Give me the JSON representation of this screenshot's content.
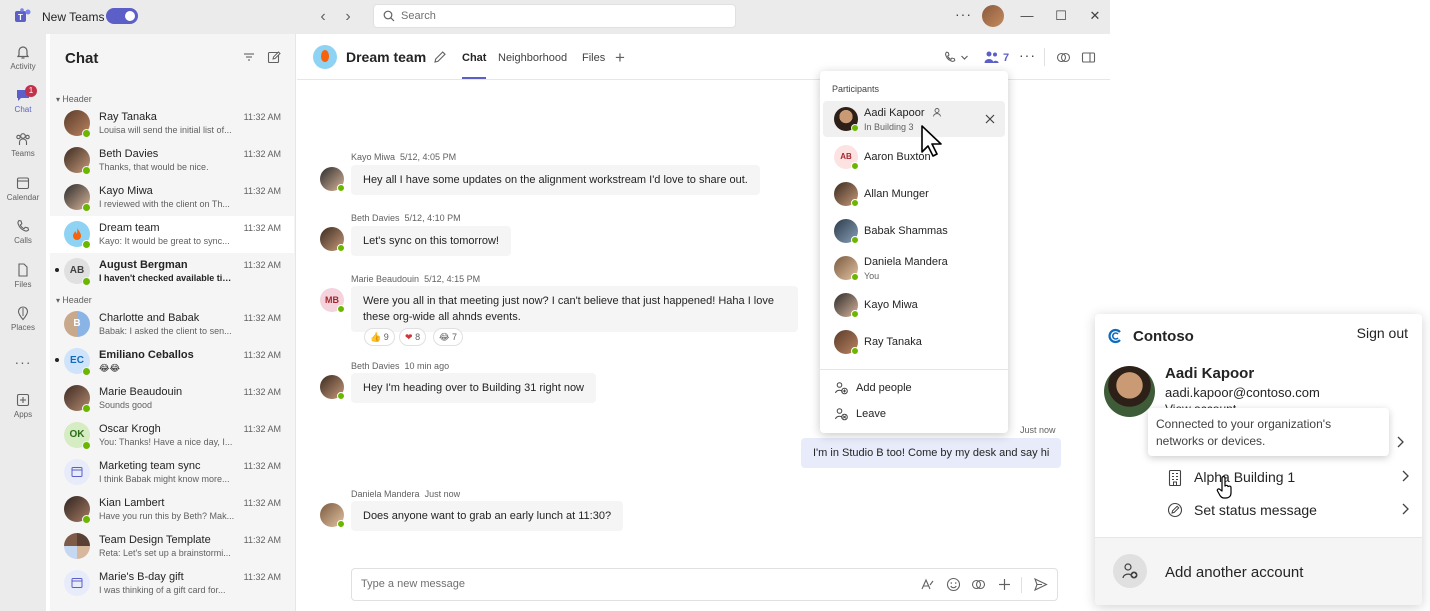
{
  "titlebar": {
    "app_label": "New Teams",
    "search_placeholder": "Search"
  },
  "rail": {
    "items": [
      {
        "label": "Activity",
        "icon": "bell-icon"
      },
      {
        "label": "Chat",
        "icon": "chat-icon",
        "badge": "1"
      },
      {
        "label": "Teams",
        "icon": "teams-icon"
      },
      {
        "label": "Calendar",
        "icon": "calendar-icon"
      },
      {
        "label": "Calls",
        "icon": "phone-icon"
      },
      {
        "label": "Files",
        "icon": "file-icon"
      },
      {
        "label": "Places",
        "icon": "location-icon"
      },
      {
        "label": "Apps",
        "icon": "apps-icon"
      }
    ]
  },
  "chatlist": {
    "title": "Chat",
    "section1": "Header",
    "section2": "Header",
    "items": [
      {
        "name": "Ray Tanaka",
        "preview": "Louisa will send the initial list of...",
        "time": "11:32 AM"
      },
      {
        "name": "Beth Davies",
        "preview": "Thanks, that would be nice.",
        "time": "11:32 AM"
      },
      {
        "name": "Kayo Miwa",
        "preview": "I reviewed with the client on Th...",
        "time": "11:32 AM"
      },
      {
        "name": "Dream team",
        "preview": "Kayo: It would be great to sync...",
        "time": "11:32 AM"
      },
      {
        "name": "August Bergman",
        "preview": "I haven't checked available tim...",
        "time": "11:32 AM",
        "initials": "AB"
      },
      {
        "name": "Charlotte and Babak",
        "preview": "Babak: I asked the client to sen...",
        "time": "11:32 AM"
      },
      {
        "name": "Emiliano Ceballos",
        "preview": "😂😂",
        "time": "11:32 AM",
        "initials": "EC"
      },
      {
        "name": "Marie Beaudouin",
        "preview": "Sounds good",
        "time": "11:32 AM"
      },
      {
        "name": "Oscar Krogh",
        "preview": "You: Thanks! Have a nice day, I...",
        "time": "11:32 AM",
        "initials": "OK"
      },
      {
        "name": "Marketing team sync",
        "preview": "I think Babak might know more...",
        "time": "11:32 AM"
      },
      {
        "name": "Kian Lambert",
        "preview": "Have you run this by Beth? Mak...",
        "time": "11:32 AM"
      },
      {
        "name": "Team Design Template",
        "preview": "Reta: Let's set up a brainstormi...",
        "time": "11:32 AM"
      },
      {
        "name": "Marie's B-day gift",
        "preview": "I was thinking of a gift card for...",
        "time": "11:32 AM"
      }
    ]
  },
  "conversation": {
    "title": "Dream team",
    "tabs": [
      "Chat",
      "Neighborhood",
      "Files"
    ],
    "participant_count": "7",
    "messages": [
      {
        "sender": "Kayo Miwa",
        "time": "5/12, 4:05 PM",
        "text": "Hey all I have some updates on the alignment workstream I'd love to share out."
      },
      {
        "sender": "Beth Davies",
        "time": "5/12, 4:10 PM",
        "text": "Let's sync on this tomorrow!"
      },
      {
        "sender": "Marie Beaudouin",
        "time": "5/12, 4:15 PM",
        "text": "Were you all in that meeting just now? I can't believe that just happened! Haha I love these org-wide all ahnds events.",
        "initials": "MB"
      },
      {
        "sender": "Beth Davies",
        "time": "10 min ago",
        "text": "Hey I'm heading over to Building 31 right now"
      },
      {
        "sender": "",
        "time": "Just now",
        "text": "I'm in Studio B too! Come by my desk and say hi"
      },
      {
        "sender": "Daniela Mandera",
        "time": "Just now",
        "text": "Does anyone want to grab an early lunch at 11:30?"
      }
    ],
    "reactions": [
      {
        "emoji": "👍",
        "count": "9"
      },
      {
        "emoji": "❤",
        "count": "8"
      },
      {
        "emoji": "😂",
        "count": "7"
      }
    ],
    "composer_placeholder": "Type a new message"
  },
  "participants": {
    "title": "Participants",
    "people": [
      {
        "name": "Aadi Kapoor",
        "sub": "In Building 3"
      },
      {
        "name": "Aaron Buxton",
        "sub": "",
        "initials": "AB"
      },
      {
        "name": "Allan Munger",
        "sub": ""
      },
      {
        "name": "Babak Shammas",
        "sub": ""
      },
      {
        "name": "Daniela Mandera",
        "sub": "You"
      },
      {
        "name": "Kayo Miwa",
        "sub": ""
      },
      {
        "name": "Ray Tanaka",
        "sub": ""
      }
    ],
    "add_people": "Add people",
    "leave": "Leave"
  },
  "account": {
    "org": "Contoso",
    "sign_out": "Sign out",
    "name": "Aadi Kapoor",
    "email": "aadi.kapoor@contoso.com",
    "view_account": "View account",
    "tooltip": "Connected to your organization's networks or devices.",
    "location": "Alpha Building 1",
    "status_message": "Set status message",
    "add_account": "Add another account"
  },
  "colors": {
    "accent": "#5b5fc7",
    "presence_available": "#6bb700",
    "badge": "#c4314b",
    "my_message_bg": "#e8ebfa"
  }
}
